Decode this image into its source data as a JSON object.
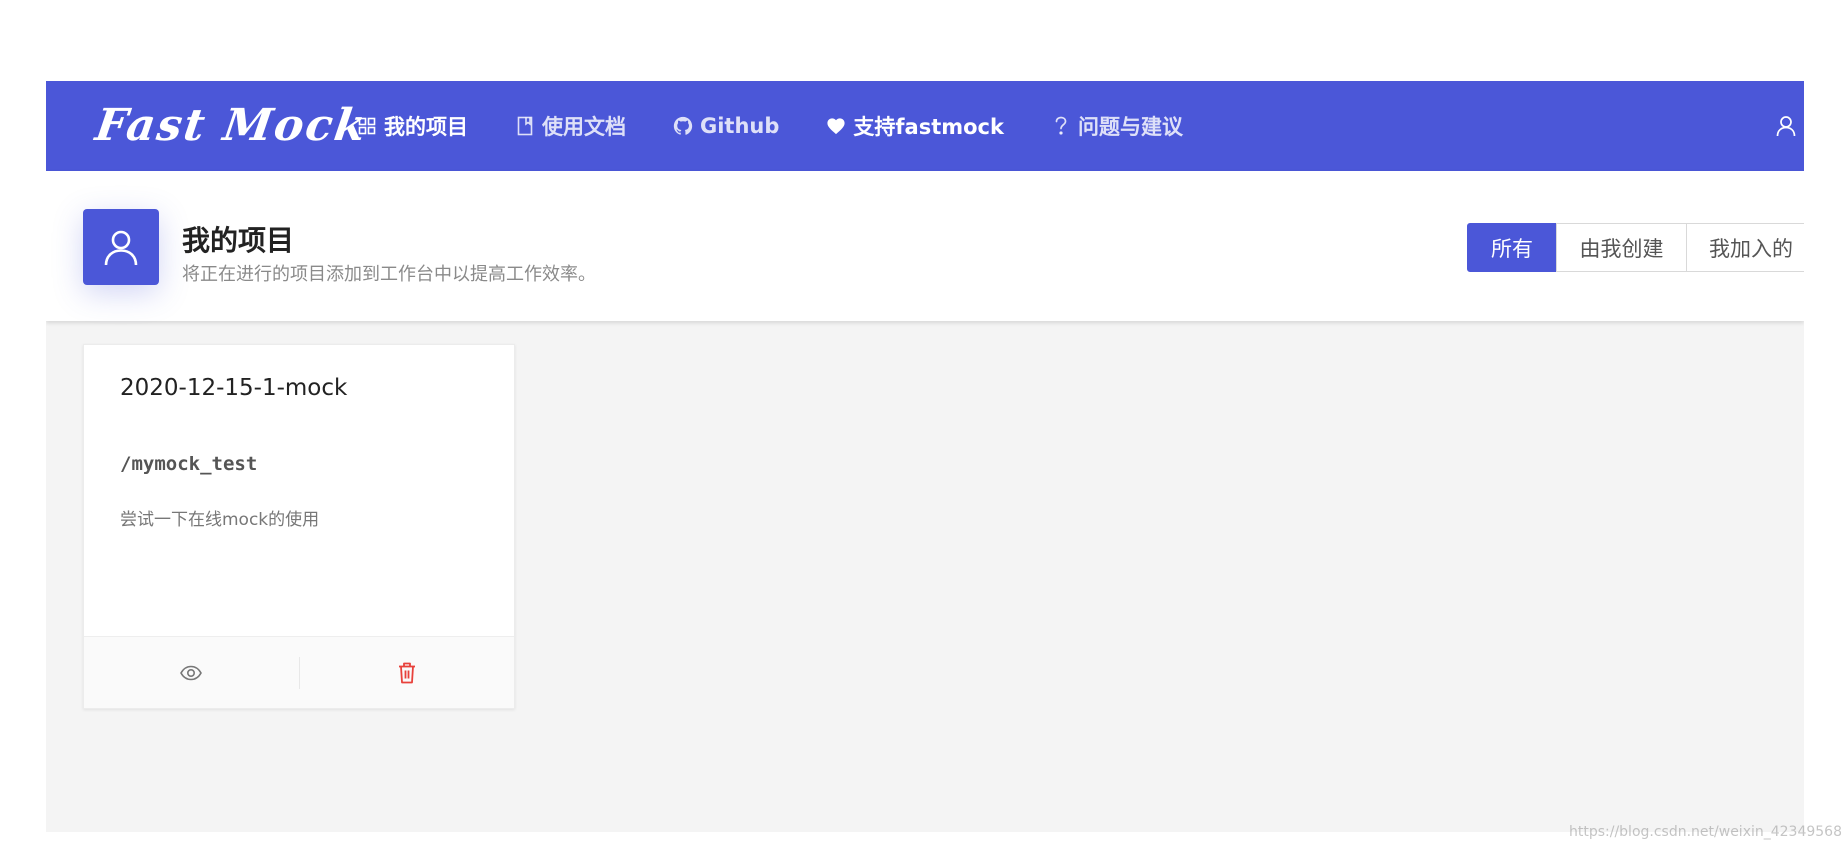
{
  "navbar": {
    "logo": "Fast Mock",
    "items": [
      {
        "label": "我的项目",
        "icon": "grid-icon",
        "active": true
      },
      {
        "label": "使用文档",
        "icon": "book-icon",
        "active": false
      },
      {
        "label": "Github",
        "icon": "github-icon",
        "active": false
      },
      {
        "label": "支持fastmock",
        "icon": "heart-icon",
        "active": false
      },
      {
        "label": "问题与建议",
        "icon": "question-icon",
        "active": false
      }
    ],
    "user_icon": "user-icon"
  },
  "header": {
    "title": "我的项目",
    "subtitle": "将正在进行的项目添加到工作台中以提高工作效率。",
    "avatar_icon": "user-icon",
    "filters": [
      {
        "label": "所有",
        "active": true
      },
      {
        "label": "由我创建",
        "active": false
      },
      {
        "label": "我加入的",
        "active": false
      }
    ]
  },
  "projects": [
    {
      "name": "2020-12-15-1-mock",
      "path": "/mymock_test",
      "description": "尝试一下在线mock的使用",
      "actions": [
        {
          "icon": "eye-icon",
          "color": "#777777"
        },
        {
          "icon": "trash-icon",
          "color": "#e8413b"
        }
      ]
    }
  ],
  "watermark": "https://blog.csdn.net/weixin_42349568",
  "colors": {
    "primary": "#4b57d8",
    "background": "#f4f4f4",
    "danger": "#e8413b"
  }
}
